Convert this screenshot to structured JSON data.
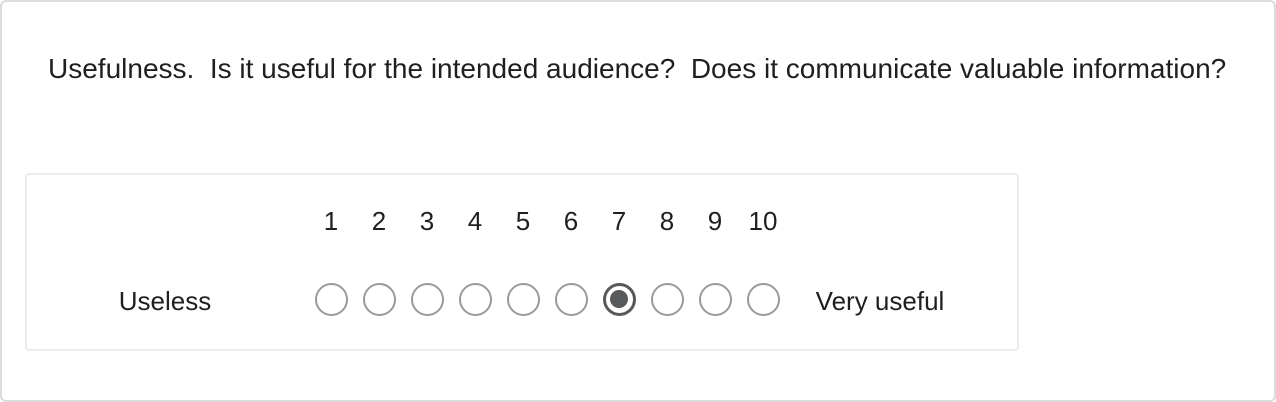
{
  "question": {
    "text": "Usefulness.  Is it useful for the intended audience?  Does it communicate valuable information?"
  },
  "scale": {
    "low_label": "Useless",
    "high_label": "Very useful",
    "options": [
      "1",
      "2",
      "3",
      "4",
      "5",
      "6",
      "7",
      "8",
      "9",
      "10"
    ],
    "selected": "7"
  },
  "colors": {
    "radio_border": "#9a9a9a",
    "radio_selected": "#58595b",
    "card_border": "#dcdcdc"
  }
}
